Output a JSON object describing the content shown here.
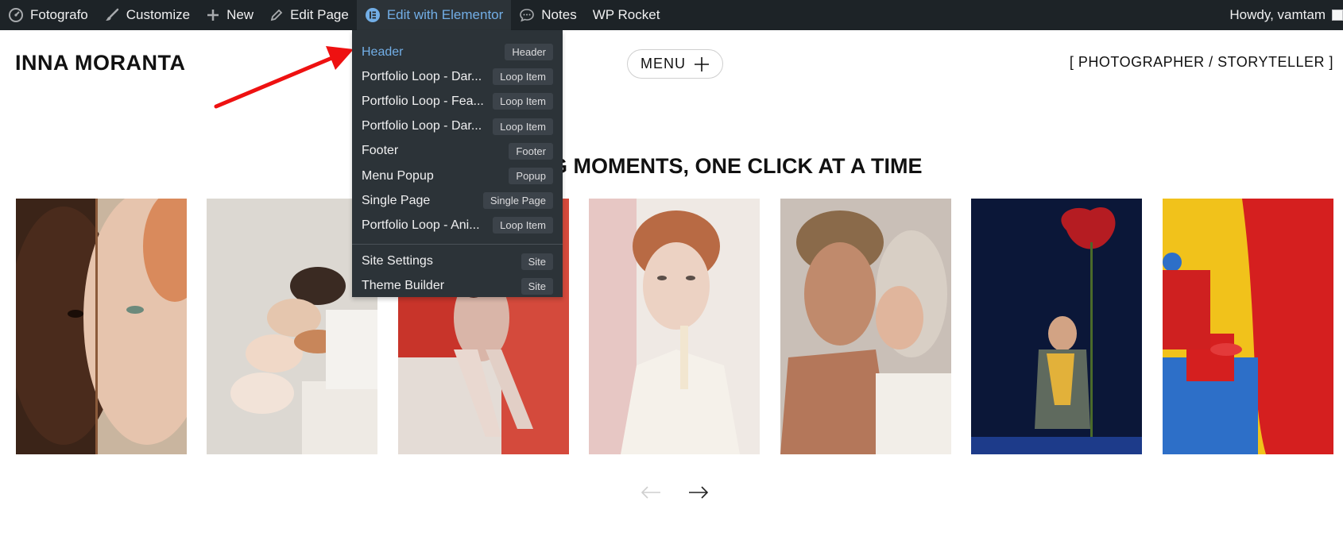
{
  "adminbar": {
    "site_name": "Fotografo",
    "customize": "Customize",
    "new": "New",
    "edit_page": "Edit Page",
    "edit_with_elementor": "Edit with Elementor",
    "notes": "Notes",
    "wp_rocket": "WP Rocket",
    "howdy": "Howdy, vamtam"
  },
  "dropdown": {
    "items": [
      {
        "label": "Header",
        "badge": "Header"
      },
      {
        "label": "Portfolio Loop - Dar...",
        "badge": "Loop Item"
      },
      {
        "label": "Portfolio Loop - Fea...",
        "badge": "Loop Item"
      },
      {
        "label": "Portfolio Loop - Dar...",
        "badge": "Loop Item"
      },
      {
        "label": "Footer",
        "badge": "Footer"
      },
      {
        "label": "Menu Popup",
        "badge": "Popup"
      },
      {
        "label": "Single Page",
        "badge": "Single Page"
      },
      {
        "label": "Portfolio Loop - Ani...",
        "badge": "Loop Item"
      }
    ],
    "site_items": [
      {
        "label": "Site Settings",
        "badge": "Site"
      },
      {
        "label": "Theme Builder",
        "badge": "Site"
      }
    ]
  },
  "site": {
    "logo": "INNA MORANTA",
    "menu_label": "MENU",
    "tagline": "[ PHOTOGRAPHER / STORYTELLER ]",
    "section_title": "G MOMENTS, ONE CLICK AT A TIME"
  },
  "colors": {
    "adminbar_bg": "#1d2327",
    "dropdown_bg": "#2c3338",
    "link_blue": "#72aee6",
    "annotation_red": "#ee1111"
  }
}
